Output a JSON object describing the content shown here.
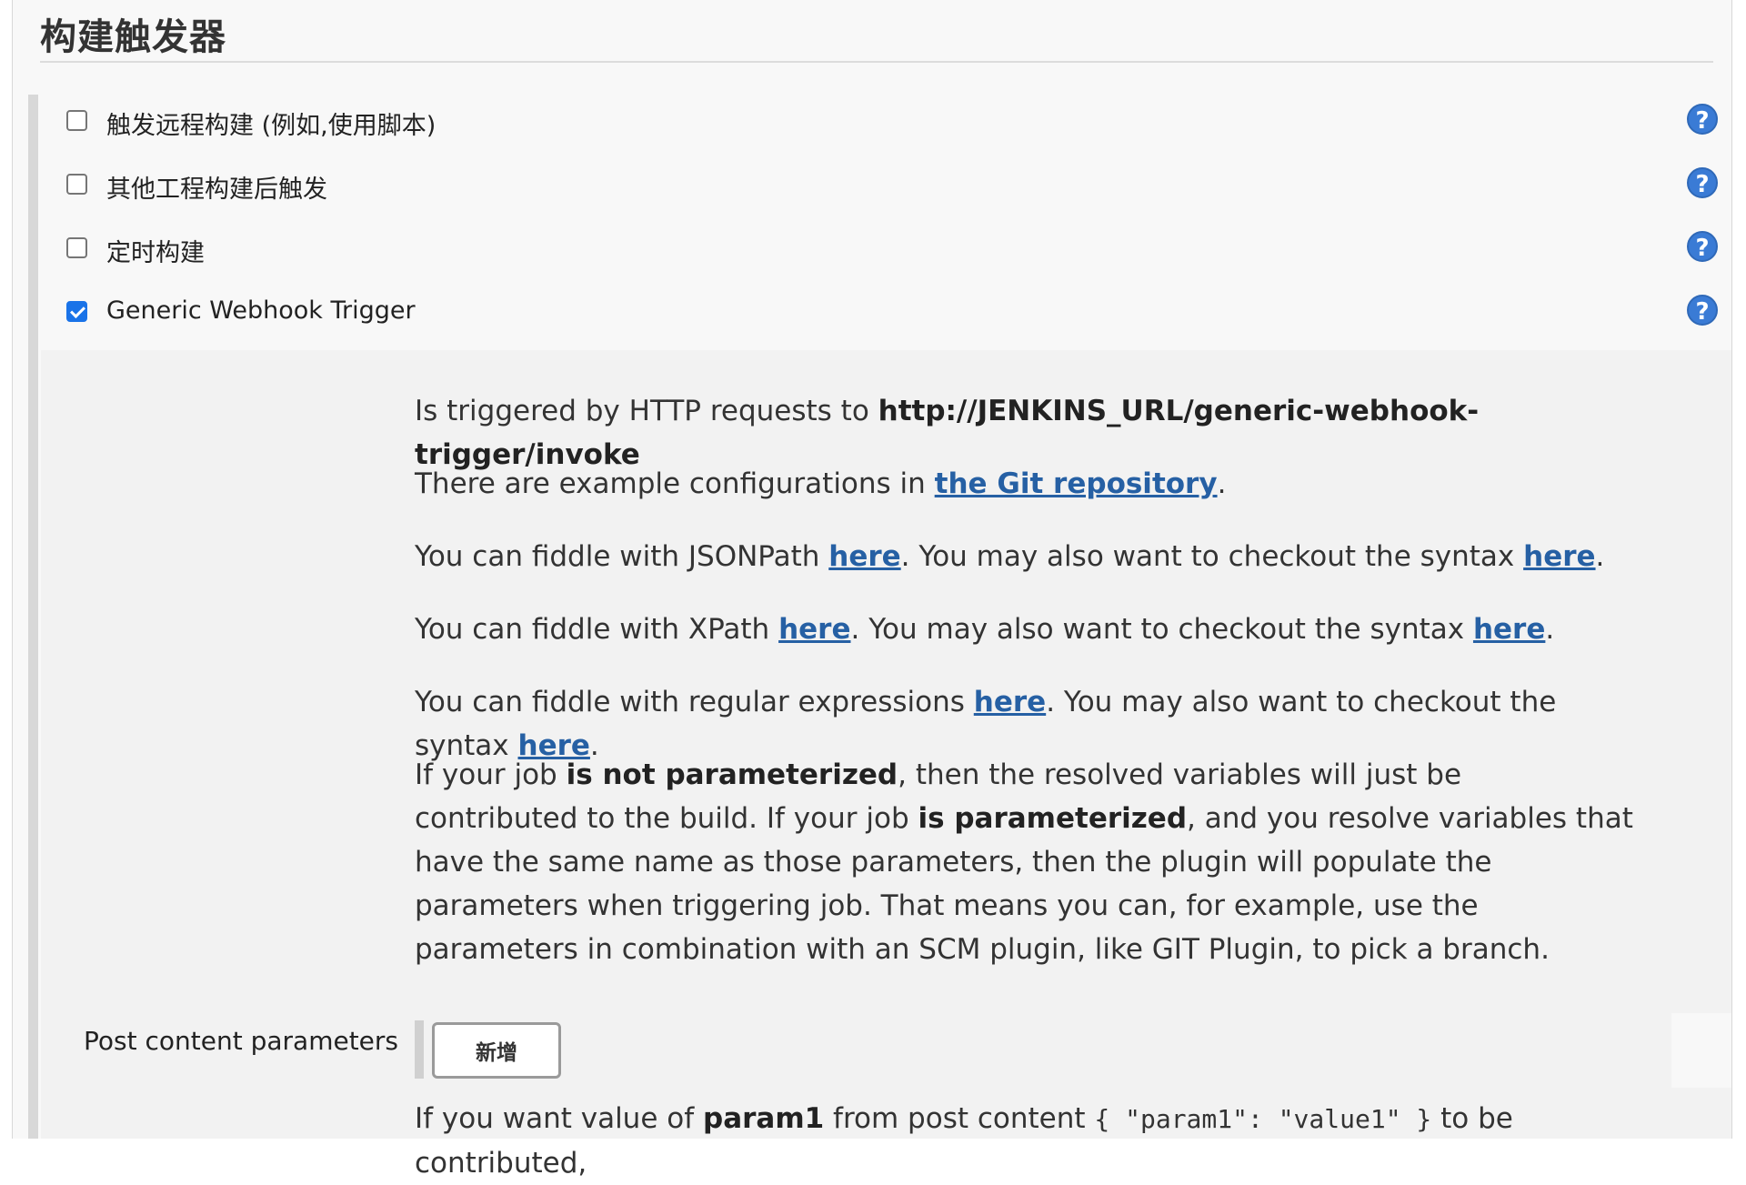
{
  "section": {
    "title": "构建触发器"
  },
  "triggers": [
    {
      "label": "触发远程构建 (例如,使用脚本)",
      "checked": false,
      "icon": "help-icon"
    },
    {
      "label": "其他工程构建后触发",
      "checked": false,
      "icon": "help-icon"
    },
    {
      "label": "定时构建",
      "checked": false,
      "icon": "help-icon"
    },
    {
      "label": "Generic Webhook Trigger",
      "checked": true,
      "icon": "help-icon"
    }
  ],
  "help_glyph": "?",
  "description": {
    "p1": {
      "text": "Is triggered by HTTP requests to ",
      "url": "http://JENKINS_URL/generic-webhook-trigger/invoke"
    },
    "p2": {
      "before": "There are example configurations in ",
      "link": "the Git repository",
      "after": "."
    },
    "p3": {
      "before": "You can fiddle with JSONPath ",
      "link1": "here",
      "middle": ". You may also want to checkout the syntax ",
      "link2": "here",
      "after": "."
    },
    "p4": {
      "before": "You can fiddle with XPath ",
      "link1": "here",
      "middle": ". You may also want to checkout the syntax ",
      "link2": "here",
      "after": "."
    },
    "p5": {
      "before": "You can fiddle with regular expressions ",
      "link1": "here",
      "middle": ". You may also want to checkout the syntax ",
      "link2": "here",
      "after": "."
    },
    "p6": {
      "t1": "If your job ",
      "b1": "is not parameterized",
      "t2": ", then the resolved variables will just be contributed to the build. If your job ",
      "b2": "is parameterized",
      "t3": ", and you resolve variables that have the same name as those parameters, then the plugin will populate the parameters when triggering job. That means you can, for example, use the parameters in combination with an SCM plugin, like GIT Plugin, to pick a branch."
    }
  },
  "post_content": {
    "label": "Post content parameters",
    "add_button": "新增",
    "help": {
      "t1": "If you want value of ",
      "b1": "param1",
      "t2": " from post content ",
      "code": "{ \"param1\": \"value1\" }",
      "t3": " to be contributed,"
    }
  },
  "colors": {
    "accent": "#3a7bd5",
    "link": "#2660a4",
    "checkbox_checked": "#1a73e8"
  }
}
